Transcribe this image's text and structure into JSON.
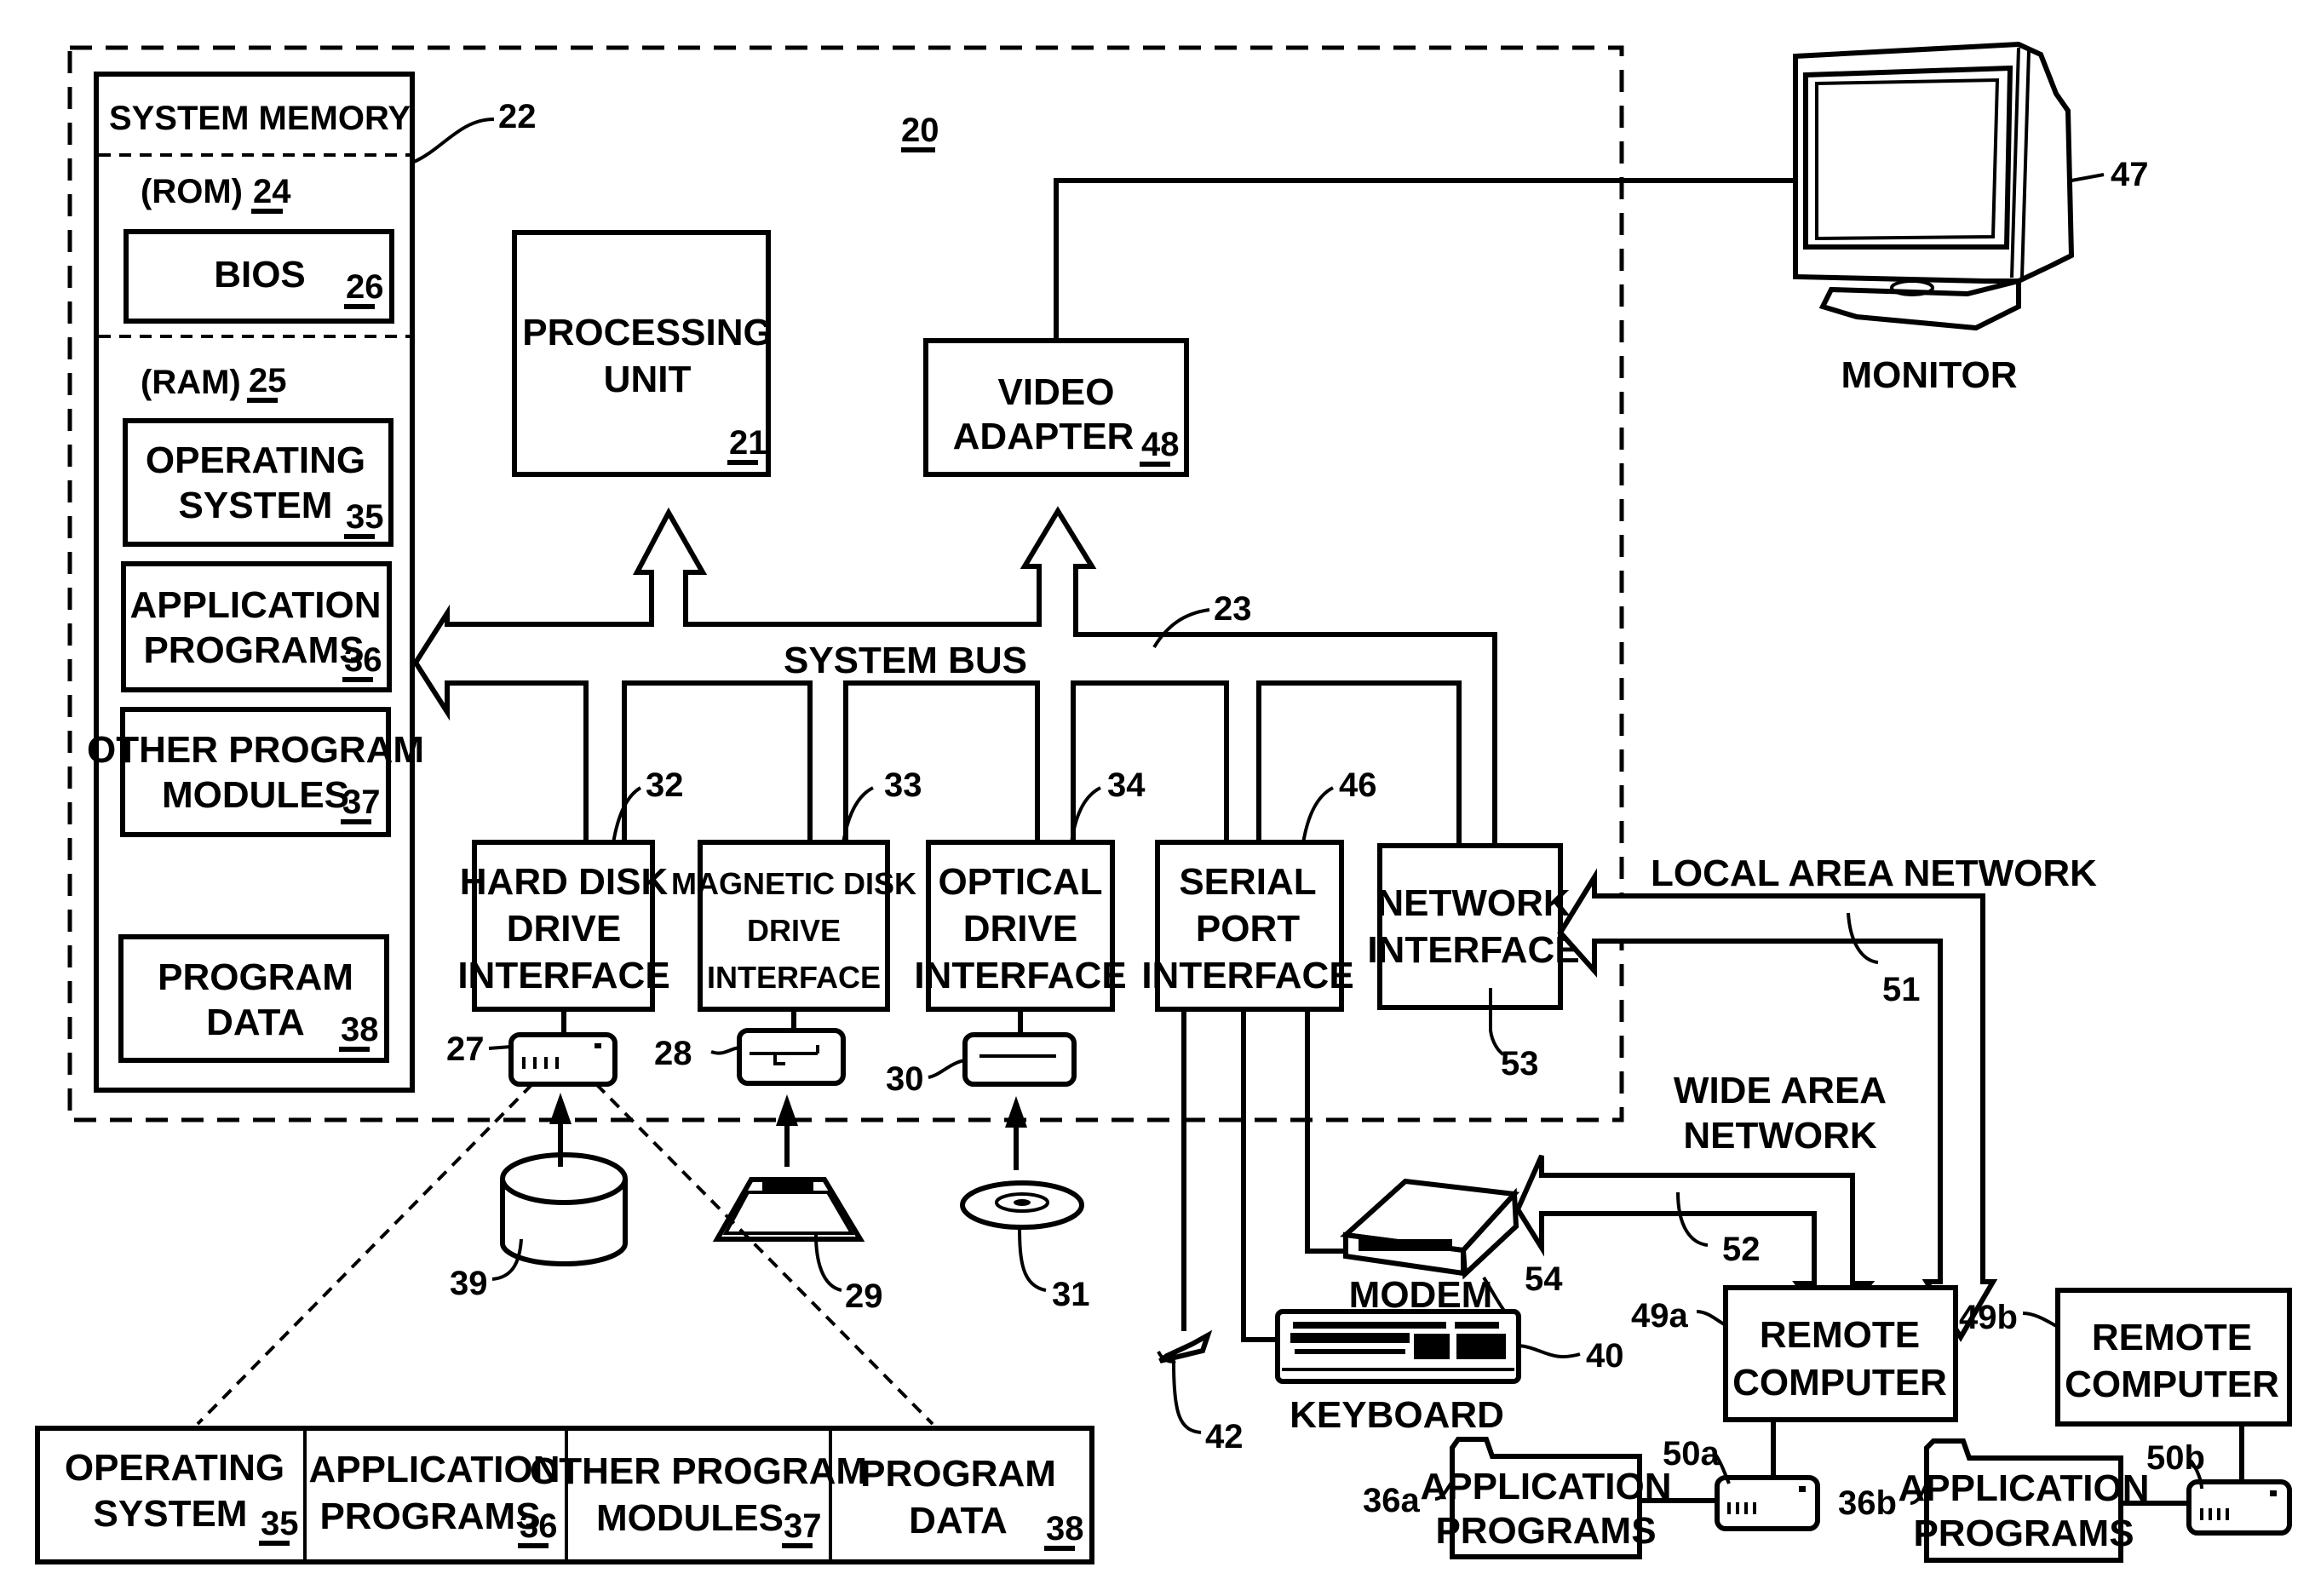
{
  "figure": {
    "computer_ref": "20",
    "system_memory": {
      "title": "SYSTEM MEMORY",
      "ref": "22",
      "rom_label": "(ROM)",
      "rom_ref": "24",
      "bios_label": "BIOS",
      "bios_ref": "26",
      "ram_label": "(RAM)",
      "ram_ref": "25",
      "items": [
        {
          "line1": "OPERATING",
          "line2": "SYSTEM",
          "ref": "35"
        },
        {
          "line1": "APPLICATION",
          "line2": "PROGRAMS",
          "ref": "36"
        },
        {
          "line1": "OTHER PROGRAM",
          "line2": "MODULES",
          "ref": "37"
        },
        {
          "line1": "PROGRAM",
          "line2": "DATA",
          "ref": "38"
        }
      ]
    },
    "processing_unit": {
      "line1": "PROCESSING",
      "line2": "UNIT",
      "ref": "21"
    },
    "video_adapter": {
      "line1": "VIDEO",
      "line2": "ADAPTER",
      "ref": "48"
    },
    "monitor": {
      "label": "MONITOR",
      "ref": "47"
    },
    "system_bus": {
      "label": "SYSTEM BUS",
      "ref": "23"
    },
    "interfaces": [
      {
        "line1": "HARD DISK",
        "line2": "DRIVE",
        "line3": "INTERFACE",
        "ref": "32"
      },
      {
        "line1": "MAGNETIC DISK",
        "line2": "DRIVE",
        "line3": "INTERFACE",
        "ref": "33"
      },
      {
        "line1": "OPTICAL",
        "line2": "DRIVE",
        "line3": "INTERFACE",
        "ref": "34"
      },
      {
        "line1": "SERIAL",
        "line2": "PORT",
        "line3": "INTERFACE",
        "ref": "46"
      },
      {
        "line1": "NETWORK",
        "line2": "INTERFACE",
        "line3": "",
        "ref": "53"
      }
    ],
    "drives": [
      {
        "ref": "27",
        "media_ref": "39"
      },
      {
        "ref": "28",
        "media_ref": "29"
      },
      {
        "ref": "30",
        "media_ref": "31"
      }
    ],
    "lan": {
      "label": "LOCAL AREA NETWORK",
      "ref": "51"
    },
    "wan": {
      "line1": "WIDE AREA",
      "line2": "NETWORK",
      "ref": "52"
    },
    "modem": {
      "label": "MODEM",
      "ref": "54"
    },
    "keyboard": {
      "label": "KEYBOARD",
      "ref": "40"
    },
    "mouse": {
      "ref": "42"
    },
    "remote_computers": [
      {
        "line1": "REMOTE",
        "line2": "COMPUTER",
        "ref": "49a",
        "storage_ref": "50a",
        "apps_line1": "APPLICATION",
        "apps_line2": "PROGRAMS",
        "apps_ref": "36a"
      },
      {
        "line1": "REMOTE",
        "line2": "COMPUTER",
        "ref": "49b",
        "storage_ref": "50b",
        "apps_line1": "APPLICATION",
        "apps_line2": "PROGRAMS",
        "apps_ref": "36b"
      }
    ],
    "disk_contents": [
      {
        "line1": "OPERATING",
        "line2": "SYSTEM",
        "ref": "35"
      },
      {
        "line1": "APPLICATION",
        "line2": "PROGRAMS",
        "ref": "36"
      },
      {
        "line1": "OTHER PROGRAM",
        "line2": "MODULES",
        "ref": "37"
      },
      {
        "line1": "PROGRAM",
        "line2": "DATA",
        "ref": "38"
      }
    ]
  }
}
